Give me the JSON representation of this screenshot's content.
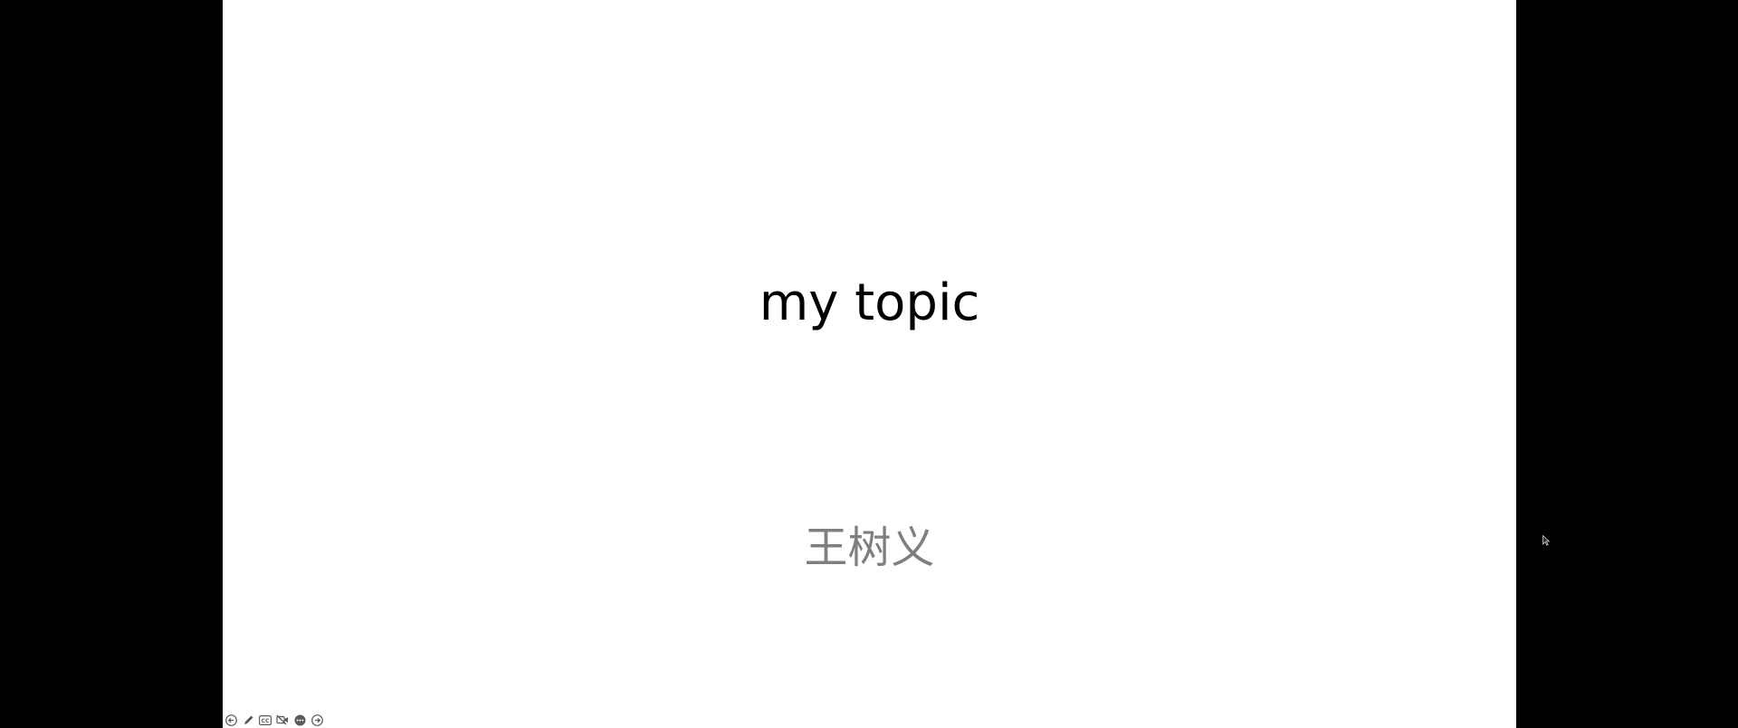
{
  "slide": {
    "title": "my topic",
    "subtitle": "王树义"
  },
  "colors": {
    "background": "#000000",
    "slide": "#ffffff",
    "title": "#000000",
    "subtitle": "#7f7f7f",
    "controls": "#5a5a5a"
  },
  "controls": {
    "icons": [
      "previous-slide-icon",
      "pen-icon",
      "subtitles-icon",
      "camera-off-icon",
      "more-options-icon",
      "next-slide-icon"
    ]
  }
}
